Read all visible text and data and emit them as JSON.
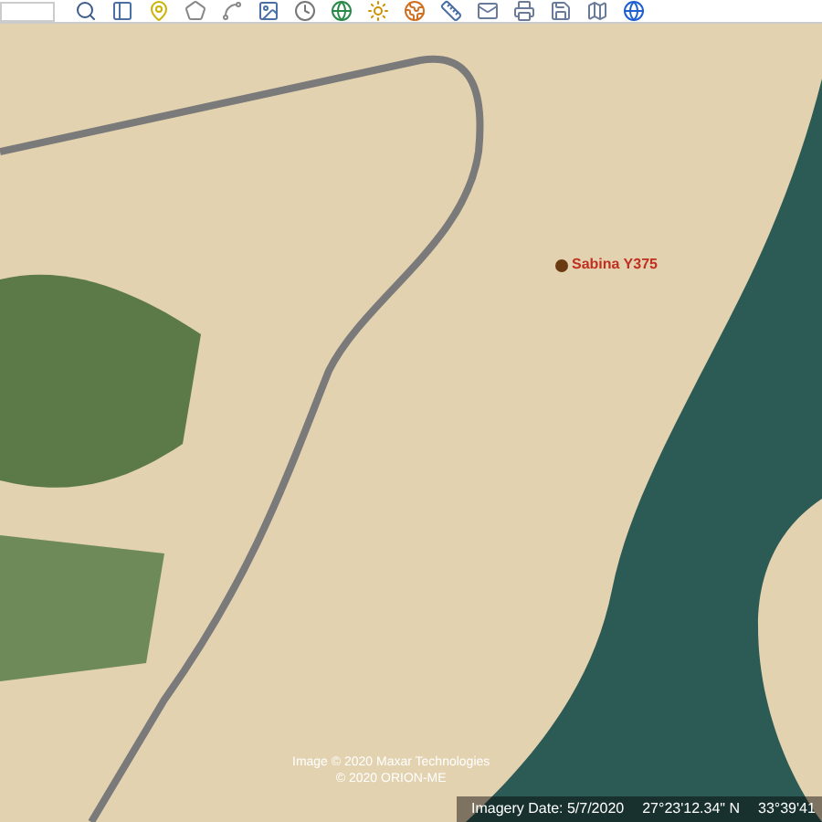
{
  "placemark": {
    "label": "Sabina Y375"
  },
  "attribution": [
    "Image © 2020 Maxar Technologies",
    "© 2020 ORION-ME"
  ],
  "status_bar": {
    "imagery_date": "Imagery Date: 5/7/2020",
    "latitude": "27°23'12.34\" N",
    "longitude": "33°39'41"
  }
}
